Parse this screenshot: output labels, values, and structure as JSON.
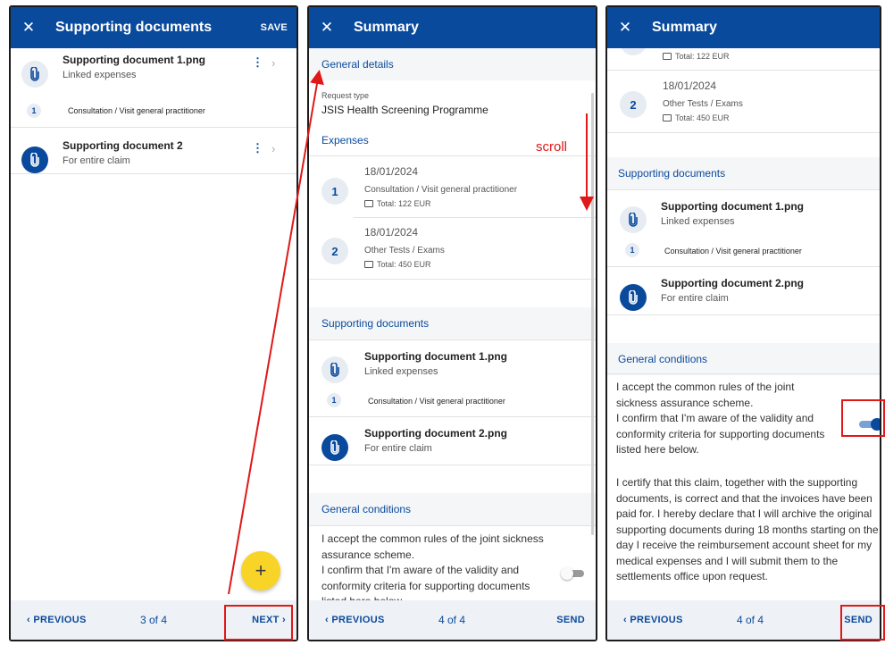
{
  "panel1": {
    "title": "Supporting documents",
    "save_label": "SAVE",
    "doc1": {
      "name": "Supporting document 1.png",
      "sub": "Linked expenses",
      "linked_num": "1",
      "linked_text": "Consultation / Visit general practitioner"
    },
    "doc2": {
      "name": "Supporting document 2",
      "sub": "For entire claim"
    },
    "fab_label": "+",
    "footer": {
      "prev": "PREVIOUS",
      "page": "3 of 4",
      "next": "NEXT"
    }
  },
  "panel2": {
    "title": "Summary",
    "general_details": "General details",
    "request_type_label": "Request type",
    "request_type_value": "JSIS Health Screening Programme",
    "expenses_label": "Expenses",
    "expenses": [
      {
        "num": "1",
        "date": "18/01/2024",
        "desc": "Consultation / Visit general practitioner",
        "total": "Total: 122 EUR"
      },
      {
        "num": "2",
        "date": "18/01/2024",
        "desc": "Other Tests / Exams",
        "total": "Total: 450 EUR"
      }
    ],
    "supporting_docs_label": "Supporting documents",
    "doc1": {
      "name": "Supporting document 1.png",
      "sub": "Linked expenses",
      "linked_num": "1",
      "linked_text": "Consultation / Visit general practitioner"
    },
    "doc2": {
      "name": "Supporting document 2.png",
      "sub": "For entire claim"
    },
    "general_conditions_label": "General conditions",
    "conditions_p1": "I accept the common rules of the joint sickness assurance scheme.",
    "conditions_p2": "I confirm that I'm aware of the validity and conformity criteria for supporting documents listed here below.",
    "toggle_on": false,
    "footer": {
      "prev": "PREVIOUS",
      "page": "4 of 4",
      "send": "SEND"
    }
  },
  "panel3": {
    "title": "Summary",
    "expense1_total": "Total: 122 EUR",
    "expense2": {
      "num": "2",
      "date": "18/01/2024",
      "desc": "Other Tests / Exams",
      "total": "Total: 450 EUR"
    },
    "supporting_docs_label": "Supporting documents",
    "doc1": {
      "name": "Supporting document 1.png",
      "sub": "Linked expenses",
      "linked_num": "1",
      "linked_text": "Consultation / Visit general practitioner"
    },
    "doc2": {
      "name": "Supporting document 2.png",
      "sub": "For entire claim"
    },
    "general_conditions_label": "General conditions",
    "conditions_p1": "I accept the common rules of the joint sickness assurance scheme.",
    "conditions_p2": "I confirm that I'm aware of the validity and conformity criteria for supporting documents listed here below.",
    "conditions_p3": "I certify that this claim, together with the supporting documents, is correct and that the invoices have been paid for. I hereby declare that I will archive the original supporting documents during 18 months starting on the day I receive the reimbursement account sheet for my medical expenses and I will submit them to the settlements office upon request.",
    "toggle_on": true,
    "footer": {
      "prev": "PREVIOUS",
      "page": "4 of 4",
      "send": "SEND"
    }
  },
  "annotation": {
    "scroll_label": "scroll"
  },
  "colors": {
    "primary": "#0a4a9c",
    "fab": "#f8d428",
    "annotation": "#e01818",
    "footer_bg": "#eef1f6"
  },
  "icons": {
    "close": "close-icon",
    "attachment": "paperclip-icon",
    "more": "more-vert-icon",
    "chevron": "chevron-right-icon",
    "wallet": "wallet-icon"
  }
}
